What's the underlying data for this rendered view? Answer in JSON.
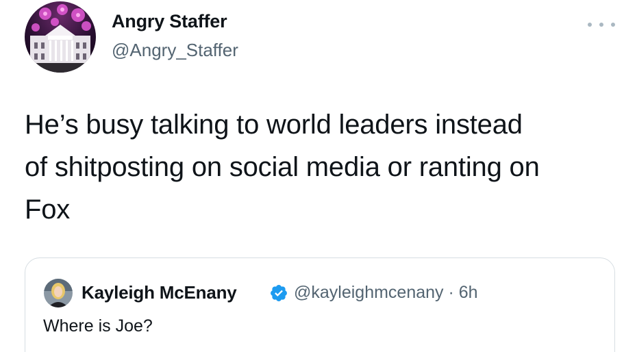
{
  "author": {
    "display_name": "Angry Staffer",
    "handle": "@Angry_Staffer",
    "avatar_icon": "white-house-fireworks-avatar"
  },
  "more_icon": "more-options-icon",
  "tweet": {
    "text": "He’s busy talking to world leaders instead\nof shitposting on social media or ranting on\nFox"
  },
  "quoted_tweet": {
    "display_name": "Kayleigh McEnany",
    "verified_icon": "verified-badge-icon",
    "handle": "@kayleighmcenany",
    "separator": "·",
    "time": "6h",
    "text": "Where is Joe?"
  },
  "colors": {
    "text": "#0f1419",
    "secondary_text": "#536471",
    "verified_blue": "#1d9bf0",
    "border": "#d6dde2"
  }
}
